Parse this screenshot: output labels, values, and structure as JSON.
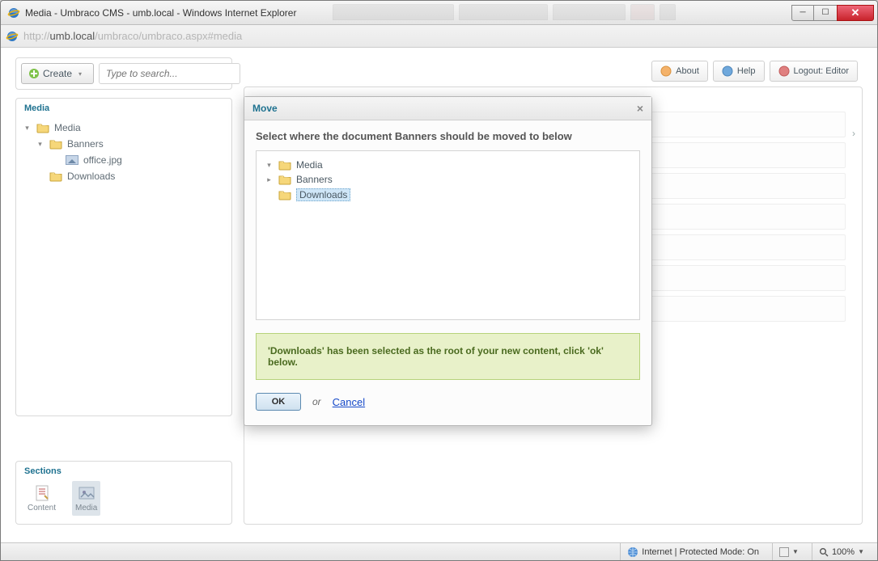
{
  "window": {
    "title": "Media - Umbraco CMS - umb.local - Windows Internet Explorer",
    "url_prefix": "http://",
    "url_host": "umb.local",
    "url_path": "/umbraco/umbraco.aspx#media"
  },
  "toolbar": {
    "create_label": "Create",
    "search_placeholder": "Type to search..."
  },
  "header_buttons": {
    "about": "About",
    "help": "Help",
    "logout": "Logout: Editor"
  },
  "tree": {
    "head": "Media",
    "root": "Media",
    "banners": "Banners",
    "office": "office.jpg",
    "downloads": "Downloads"
  },
  "sections": {
    "head": "Sections",
    "content": "Content",
    "media": "Media"
  },
  "dialog": {
    "title": "Move",
    "prompt": "Select where the document Banners should be moved to below",
    "tree_root": "Media",
    "tree_banners": "Banners",
    "tree_downloads": "Downloads",
    "alert": "'Downloads' has been selected as the root of your new content, click 'ok' below.",
    "ok": "OK",
    "or": "or",
    "cancel": "Cancel"
  },
  "status": {
    "mode": "Internet | Protected Mode: On",
    "zoom": "100%"
  }
}
